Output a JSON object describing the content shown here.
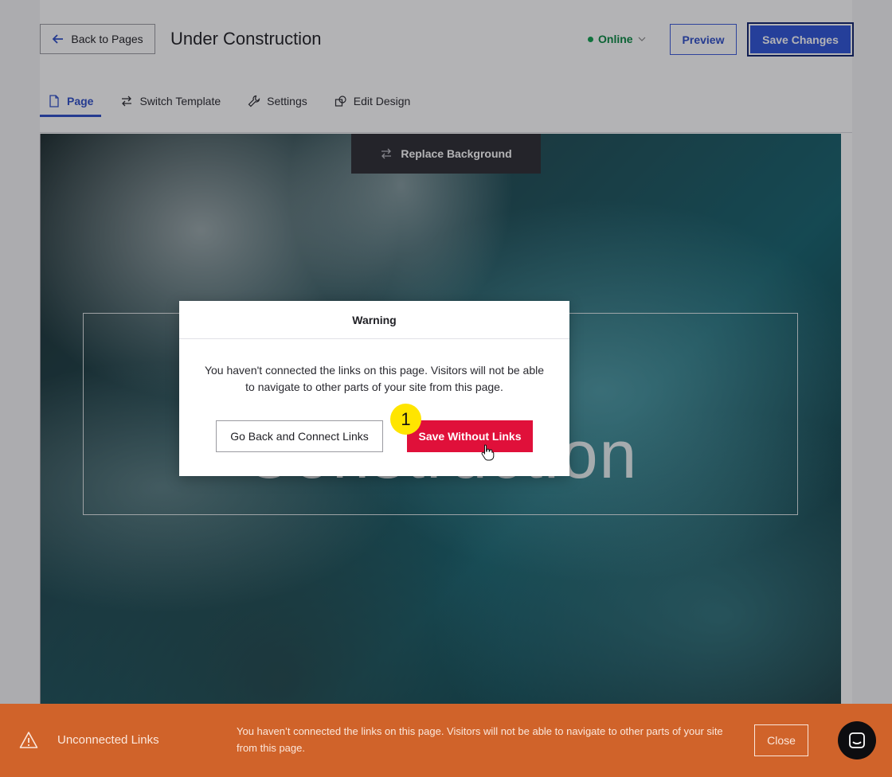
{
  "header": {
    "back_label": "Back to Pages",
    "page_title": "Under Construction",
    "status_label": "Online",
    "preview_label": "Preview",
    "save_label": "Save Changes"
  },
  "tabs": [
    {
      "label": "Page",
      "icon": "page-icon",
      "active": true
    },
    {
      "label": "Switch Template",
      "icon": "swap-arrows-icon",
      "active": false
    },
    {
      "label": "Settings",
      "icon": "wrench-icon",
      "active": false
    },
    {
      "label": "Edit Design",
      "icon": "design-shapes-icon",
      "active": false
    }
  ],
  "canvas": {
    "replace_background_label": "Replace Background",
    "headline_text": "Construction"
  },
  "modal": {
    "title": "Warning",
    "message": "You haven't connected the links on this page. Visitors will not be able to navigate to other parts of your site from this page.",
    "go_back_label": "Go Back and Connect Links",
    "save_without_label": "Save Without Links"
  },
  "annotation": {
    "step_number": "1"
  },
  "banner": {
    "title": "Unconnected Links",
    "message": "You haven’t connected the links on this page. Visitors will not be able to navigate to other parts of your site from this page.",
    "close_label": "Close"
  },
  "colors": {
    "accent": "#2f54d8",
    "danger": "#e0103a",
    "banner": "#d0632a",
    "online": "#0fa04f",
    "badge": "#ffe500"
  }
}
